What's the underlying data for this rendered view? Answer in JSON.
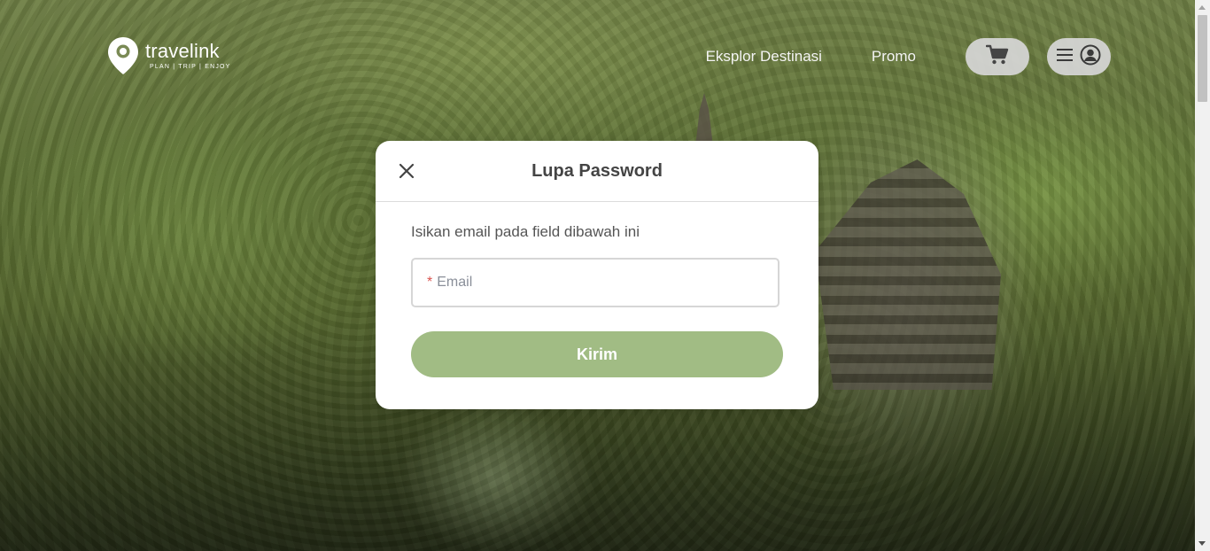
{
  "brand": {
    "name": "travelink",
    "tagline": "PLAN | TRIP | ENJOY"
  },
  "nav": {
    "links": [
      "Eksplor Destinasi",
      "Promo"
    ],
    "cart_icon": "cart-icon",
    "menu_icon": "hamburger-icon",
    "account_icon": "user-circle-icon"
  },
  "modal": {
    "title": "Lupa Password",
    "close_icon": "close-icon",
    "description": "Isikan email pada field dibawah ini",
    "email_required_marker": "*",
    "email_placeholder": "Email",
    "email_value": "",
    "submit_label": "Kirim"
  },
  "colors": {
    "accent": "#a1bc84",
    "required": "#d9534f",
    "pill_bg": "#d7d7d7"
  }
}
